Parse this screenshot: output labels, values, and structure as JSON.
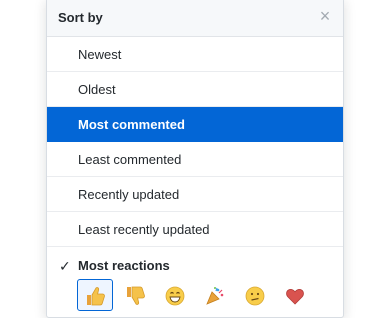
{
  "header": {
    "title": "Sort by",
    "close_glyph": "×"
  },
  "sort_options": [
    {
      "label": "Newest",
      "selected": false
    },
    {
      "label": "Oldest",
      "selected": false
    },
    {
      "label": "Most commented",
      "selected": true
    },
    {
      "label": "Least commented",
      "selected": false
    },
    {
      "label": "Recently updated",
      "selected": false
    },
    {
      "label": "Least recently updated",
      "selected": false
    }
  ],
  "reactions": {
    "check_glyph": "✓",
    "label": "Most reactions",
    "selected_index": 0,
    "emojis": [
      {
        "name": "thumbs-up-icon"
      },
      {
        "name": "thumbs-down-icon"
      },
      {
        "name": "laugh-icon"
      },
      {
        "name": "hooray-icon"
      },
      {
        "name": "confused-icon"
      },
      {
        "name": "heart-icon"
      }
    ]
  },
  "colors": {
    "accent": "#0366d6",
    "header_bg": "#f6f8fa",
    "text": "#24292e"
  }
}
